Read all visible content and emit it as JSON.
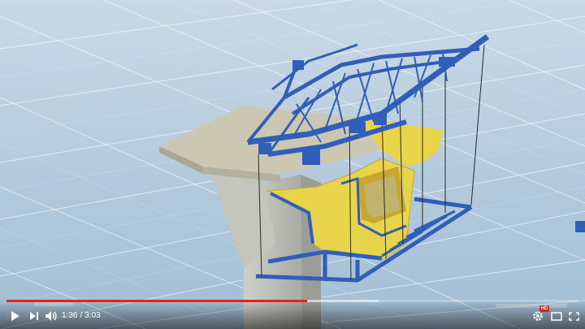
{
  "player": {
    "current_time": "1:36",
    "separator": "/",
    "duration": "3:03",
    "progress_fraction": 0.525,
    "buffered_fraction": 0.65,
    "quality_badge": "HD",
    "colors": {
      "accent": "#e62117",
      "control": "#ffffff",
      "gantry": "#2f5fb8",
      "formwork": "#e8d44a",
      "deck": "#c7c2b0",
      "pier": "#bdbdb6"
    }
  },
  "controls": {
    "play": "play-icon",
    "next": "next-icon",
    "volume": "volume-icon",
    "settings": "gear-icon",
    "miniplayer": "miniplayer-icon",
    "fullscreen": "fullscreen-icon"
  }
}
